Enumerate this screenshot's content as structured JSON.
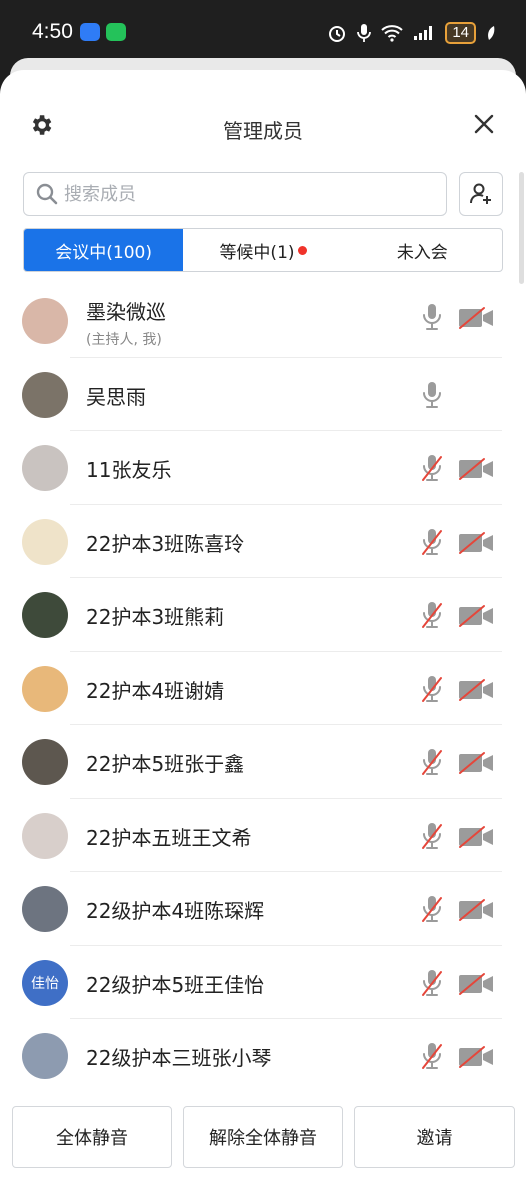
{
  "status_bar": {
    "time": "4:50",
    "battery": "14"
  },
  "header": {
    "title": "管理成员"
  },
  "search": {
    "placeholder": "搜索成员"
  },
  "tabs": [
    {
      "label": "会议中(100)",
      "active": true
    },
    {
      "label": "等候中(1)",
      "active": false,
      "badge": true
    },
    {
      "label": "未入会",
      "active": false
    }
  ],
  "members": [
    {
      "name": "墨染微巡",
      "sub": "(主持人, 我)",
      "mic_muted": false,
      "camera_off": true,
      "avatar_color": "#d9b7a8",
      "avatar_text": ""
    },
    {
      "name": "吴思雨",
      "sub": "",
      "mic_muted": false,
      "camera_off": null,
      "avatar_color": "#7b7368",
      "avatar_text": ""
    },
    {
      "name": "11张友乐",
      "sub": "",
      "mic_muted": true,
      "camera_off": true,
      "avatar_color": "#c9c3c0",
      "avatar_text": ""
    },
    {
      "name": "22护本3班陈喜玲",
      "sub": "",
      "mic_muted": true,
      "camera_off": true,
      "avatar_color": "#efe3c9",
      "avatar_text": ""
    },
    {
      "name": "22护本3班熊莉",
      "sub": "",
      "mic_muted": true,
      "camera_off": true,
      "avatar_color": "#3e4a3a",
      "avatar_text": ""
    },
    {
      "name": "22护本4班谢婧",
      "sub": "",
      "mic_muted": true,
      "camera_off": true,
      "avatar_color": "#e8b87a",
      "avatar_text": ""
    },
    {
      "name": "22护本5班张于鑫",
      "sub": "",
      "mic_muted": true,
      "camera_off": true,
      "avatar_color": "#5d574f",
      "avatar_text": ""
    },
    {
      "name": "22护本五班王文希",
      "sub": "",
      "mic_muted": true,
      "camera_off": true,
      "avatar_color": "#d8cfcb",
      "avatar_text": ""
    },
    {
      "name": "22级护本4班陈琛辉",
      "sub": "",
      "mic_muted": true,
      "camera_off": true,
      "avatar_color": "#6d7480",
      "avatar_text": ""
    },
    {
      "name": "22级护本5班王佳怡",
      "sub": "",
      "mic_muted": true,
      "camera_off": true,
      "avatar_color": "#3f6fc6",
      "avatar_text": "佳怡"
    },
    {
      "name": "22级护本三班张小琴",
      "sub": "",
      "mic_muted": true,
      "camera_off": true,
      "avatar_color": "#8d9bb0",
      "avatar_text": ""
    }
  ],
  "footer": {
    "mute_all": "全体静音",
    "unmute_all": "解除全体静音",
    "invite": "邀请"
  },
  "colors": {
    "accent": "#1a73e8",
    "muted_red": "#e5463a",
    "icon_gray": "#9b9b9b"
  }
}
